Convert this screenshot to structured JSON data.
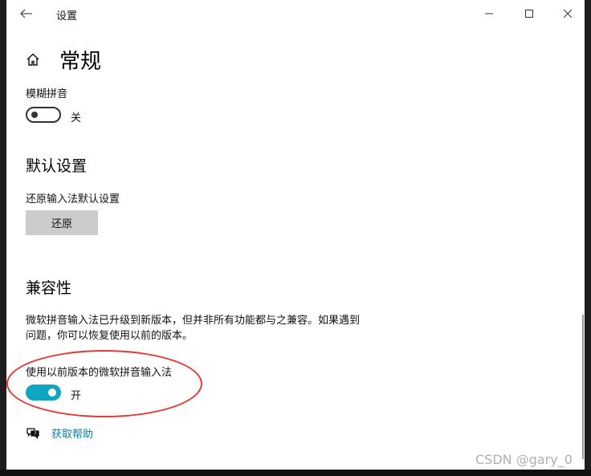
{
  "window": {
    "title": "设置",
    "controls": {
      "back": "arrow-left-icon",
      "minimize": "minimize-icon",
      "maximize": "maximize-icon",
      "close": "close-icon"
    }
  },
  "page": {
    "title": "常规",
    "icon": "home-icon"
  },
  "fuzzy_pinyin": {
    "label": "模糊拼音",
    "toggle_state": "关",
    "on": false
  },
  "default_settings": {
    "title": "默认设置",
    "reset_label": "还原输入法默认设置",
    "reset_button": "还原"
  },
  "compatibility": {
    "title": "兼容性",
    "description_line1": "微软拼音输入法已升级到新版本，但并非所有功能都与之兼容。如果遇到",
    "description_line2": "问题，你可以恢复使用以前的版本。",
    "legacy_label": "使用以前版本的微软拼音输入法",
    "toggle_state": "开",
    "on": true
  },
  "help": {
    "icon": "chat-help-icon",
    "link": "获取帮助"
  },
  "watermark": "CSDN @gary_0",
  "colors": {
    "toggle_on": "#10a6bf",
    "link": "#0a7ea8",
    "annotation": "#e53935",
    "button_bg": "#cccccc"
  }
}
